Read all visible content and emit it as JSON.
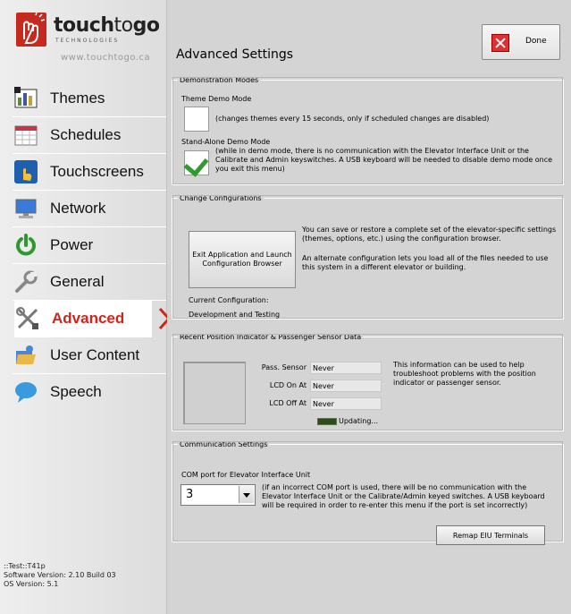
{
  "brand": {
    "name_bold": "touch",
    "name_thin": "to",
    "name_bold2": "go",
    "subtitle": "TECHNOLOGIES",
    "url": "www.touchtogo.ca"
  },
  "sidebar": {
    "items": [
      {
        "label": "Themes",
        "icon": "themes-icon"
      },
      {
        "label": "Schedules",
        "icon": "calendar-icon"
      },
      {
        "label": "Touchscreens",
        "icon": "touch-hand-icon"
      },
      {
        "label": "Network",
        "icon": "monitor-icon"
      },
      {
        "label": "Power",
        "icon": "power-icon"
      },
      {
        "label": "General",
        "icon": "wrench-icon"
      },
      {
        "label": "Advanced",
        "icon": "tools-icon",
        "active": true
      },
      {
        "label": "User Content",
        "icon": "folder-icon"
      },
      {
        "label": "Speech",
        "icon": "speech-bubble-icon"
      }
    ],
    "version_lines": [
      "::Test::T41p",
      "Software Version: 2.10 Build 03",
      "OS Version: 5.1"
    ]
  },
  "header": {
    "title": "Advanced Settings",
    "done_label": "Done"
  },
  "demo": {
    "legend": "Demonstration Modes",
    "theme_label": "Theme Demo Mode",
    "theme_desc": "(changes themes every 15 seconds, only if scheduled changes are disabled)",
    "standalone_label": "Stand-Alone Demo Mode",
    "standalone_desc": "(while in demo mode, there is no communication with the Elevator Interface Unit or the Calibrate and Admin keyswitches.  A USB keyboard will be needed to disable demo mode once you exit this menu)",
    "theme_checked": false,
    "standalone_checked": true
  },
  "config": {
    "legend": "Change Configurations",
    "button_label": "Exit Application and Launch Configuration Browser",
    "desc1": "You can save or restore a complete set of the elevator-specific settings (themes, options, etc.) using the configuration browser.",
    "desc2": "An alternate configuration lets you load all of the files needed to use this system in a different elevator or building.",
    "current_label": "Current Configuration:",
    "current_value": "Development and Testing"
  },
  "sensor": {
    "legend": "Recent Position Indicator & Passenger Sensor Data",
    "rows": [
      {
        "label": "Pass. Sensor",
        "value": "Never"
      },
      {
        "label": "LCD On At",
        "value": "Never"
      },
      {
        "label": "LCD Off At",
        "value": "Never"
      }
    ],
    "updating": "Updating...",
    "desc": "This information can be used to help troubleshoot problems with the position indicator or passenger sensor."
  },
  "comm": {
    "legend": "Communication Settings",
    "port_label": "COM port for Elevator Interface Unit",
    "port_value": "3",
    "desc": "(if an incorrect COM port is used, there will be no communication with the Elevator Interface Unit or the Calibrate/Admin keyed switches.  A USB keyboard will be required in order to re-enter this menu if the port is set incorrectly)",
    "remap_label": "Remap EIU Terminals"
  }
}
